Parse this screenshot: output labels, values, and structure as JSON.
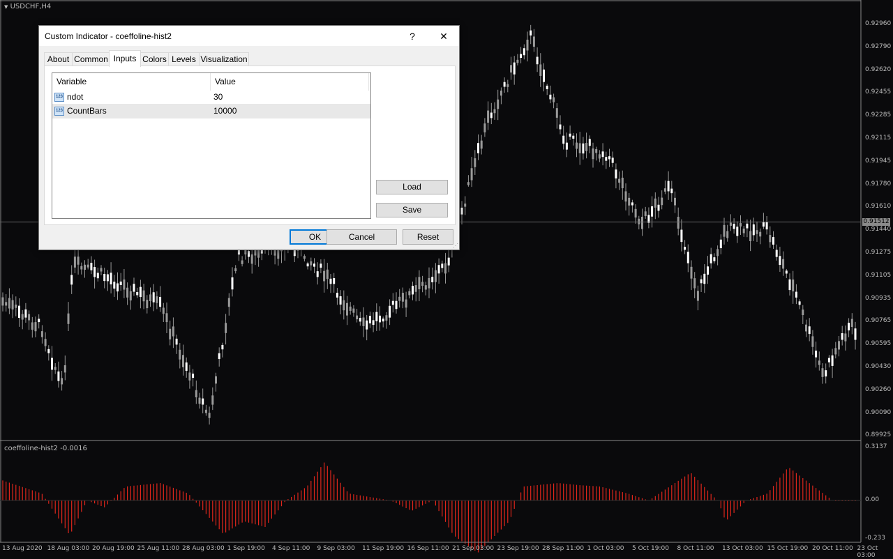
{
  "chart": {
    "symbol_label": "USDCHF,H4",
    "price_axis": [
      "0.92960",
      "0.92790",
      "0.92620",
      "0.92455",
      "0.92285",
      "0.92115",
      "0.91945",
      "0.91780",
      "0.91610",
      "0.91440",
      "0.91275",
      "0.91105",
      "0.90935",
      "0.90765",
      "0.90595",
      "0.90430",
      "0.90260",
      "0.90090",
      "0.89925"
    ],
    "current_price": "0.91512",
    "time_axis": [
      "13 Aug 2020",
      "18 Aug 03:00",
      "20 Aug 19:00",
      "25 Aug 11:00",
      "28 Aug 03:00",
      "1 Sep 19:00",
      "4 Sep 11:00",
      "9 Sep 03:00",
      "11 Sep 19:00",
      "16 Sep 11:00",
      "21 Sep 03:00",
      "23 Sep 19:00",
      "28 Sep 11:00",
      "1 Oct 03:00",
      "5 Oct 19:00",
      "8 Oct 11:00",
      "13 Oct 03:00",
      "15 Oct 19:00",
      "20 Oct 11:00",
      "23 Oct 03:00"
    ],
    "colors": {
      "background": "#0a0a0c",
      "candle": "#9a9a9a",
      "histogram": "#e0261c",
      "grid_line": "#8a8a8a"
    }
  },
  "indicator": {
    "label": "coeffoline-hist2 -0.0016",
    "axis": [
      "0.3137",
      "0.00",
      "-0.233"
    ]
  },
  "dialog": {
    "title": "Custom Indicator - coeffoline-hist2",
    "help_glyph": "?",
    "close_glyph": "✕",
    "tabs": [
      {
        "label": "About"
      },
      {
        "label": "Common"
      },
      {
        "label": "Inputs"
      },
      {
        "label": "Colors"
      },
      {
        "label": "Levels"
      },
      {
        "label": "Visualization"
      }
    ],
    "active_tab": "Inputs",
    "grid": {
      "headers": [
        "Variable",
        "Value"
      ],
      "icon_text": "123",
      "rows": [
        {
          "variable": "ndot",
          "value": "30"
        },
        {
          "variable": "CountBars",
          "value": "10000"
        }
      ]
    },
    "buttons": {
      "load": "Load",
      "save": "Save",
      "ok": "OK",
      "cancel": "Cancel",
      "reset": "Reset"
    }
  }
}
